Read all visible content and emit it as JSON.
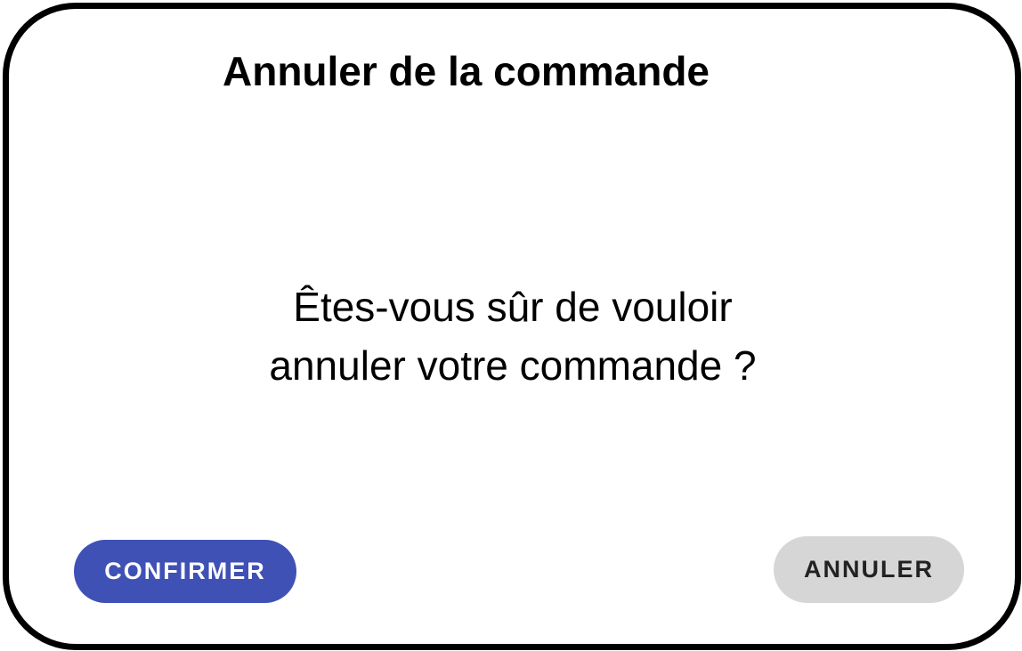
{
  "dialog": {
    "title": "Annuler de la commande",
    "message_line1": "Êtes-vous sûr de vouloir",
    "message_line2": "annuler votre commande ?",
    "confirm_label": "CONFIRMER",
    "cancel_label": "ANNULER"
  },
  "colors": {
    "confirm_bg": "#3f51b5",
    "confirm_text": "#ffffff",
    "cancel_bg": "#d6d6d6",
    "cancel_text": "#222222",
    "border": "#000000"
  }
}
